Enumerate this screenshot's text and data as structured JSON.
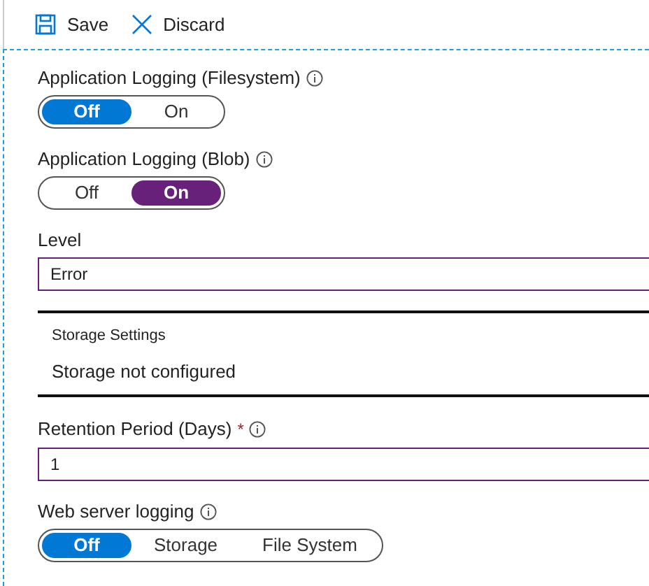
{
  "toolbar": [
    {
      "label": "Save"
    },
    {
      "label": "Discard"
    }
  ],
  "fields": [
    {
      "kind": "toggle",
      "label": "Application Logging (Filesystem)",
      "info": true,
      "color": "#0078d4",
      "options": [
        {
          "label": "Off",
          "selected": true
        },
        {
          "label": "On",
          "selected": false
        }
      ]
    },
    {
      "kind": "toggle",
      "label": "Application Logging (Blob)",
      "info": true,
      "color": "#68217a",
      "options": [
        {
          "label": "Off",
          "selected": false
        },
        {
          "label": "On",
          "selected": true
        }
      ]
    },
    {
      "kind": "select",
      "label": "Level",
      "value": "Error"
    },
    {
      "kind": "storage",
      "title": "Storage Settings",
      "value": "Storage not configured"
    },
    {
      "kind": "input",
      "label": "Retention Period (Days)",
      "required_mark": "*",
      "info": true,
      "value": "1"
    },
    {
      "kind": "toggle",
      "label": "Web server logging",
      "info": true,
      "color": "#0078d4",
      "options": [
        {
          "label": "Off",
          "selected": true
        },
        {
          "label": "Storage",
          "selected": false
        },
        {
          "label": "File System",
          "selected": false
        }
      ]
    }
  ]
}
